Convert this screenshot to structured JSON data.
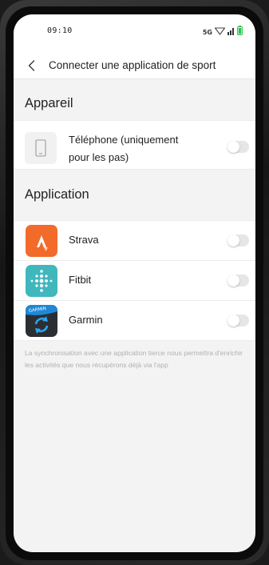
{
  "status_bar": {
    "time": "09:10",
    "network": "5G"
  },
  "header": {
    "title": "Connecter une application de sport"
  },
  "device_section": {
    "title": "Appareil",
    "items": [
      {
        "label_line1": "Téléphone (uniquement",
        "label_line2": "pour les pas",
        "label_line2_suffix": ")",
        "enabled": false,
        "icon": "phone-icon"
      }
    ]
  },
  "app_section": {
    "title": "Application",
    "items": [
      {
        "label": "Strava",
        "enabled": false,
        "icon": "strava-icon",
        "color": "#f26b2a"
      },
      {
        "label": "Fitbit",
        "enabled": false,
        "icon": "fitbit-icon",
        "color": "#3fb7bd"
      },
      {
        "label": "Garmin",
        "enabled": false,
        "icon": "garmin-icon",
        "color": "#2b2f33",
        "icon_text": "GARMIN"
      }
    ]
  },
  "note": "La synchronisation avec une application tierce nous permettra d'enrichir les activités que nous récupérons déjà via l'app",
  "colors": {
    "background": "#f3f3f3",
    "toggle_off": "#e6e6e6"
  }
}
